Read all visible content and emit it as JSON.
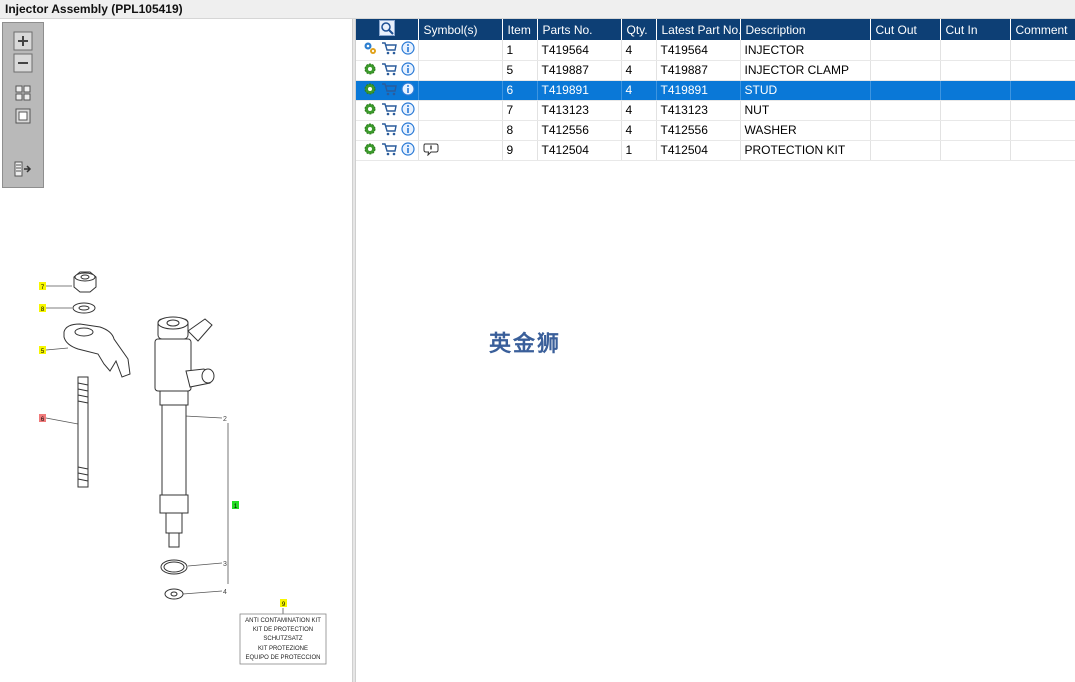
{
  "window": {
    "title": "Injector Assembly (PPL105419)"
  },
  "toolbar": {
    "buttons": [
      "zoom-in",
      "zoom-out",
      "fit-all",
      "fit-window",
      "export"
    ]
  },
  "table": {
    "columns": [
      "",
      "Symbol(s)",
      "Item",
      "Parts No.",
      "Qty.",
      "Latest Part No.",
      "Description",
      "Cut Out",
      "Cut In",
      "Comment"
    ],
    "rows": [
      {
        "item": "1",
        "part_no": "T419564",
        "qty": "4",
        "latest": "T419564",
        "description": "INJECTOR",
        "cut_out": "",
        "cut_in": "",
        "comment": "",
        "symbol": "",
        "selected": false
      },
      {
        "item": "5",
        "part_no": "T419887",
        "qty": "4",
        "latest": "T419887",
        "description": "INJECTOR CLAMP",
        "cut_out": "",
        "cut_in": "",
        "comment": "",
        "symbol": "",
        "selected": false
      },
      {
        "item": "6",
        "part_no": "T419891",
        "qty": "4",
        "latest": "T419891",
        "description": "STUD",
        "cut_out": "",
        "cut_in": "",
        "comment": "",
        "symbol": "",
        "selected": true
      },
      {
        "item": "7",
        "part_no": "T413123",
        "qty": "4",
        "latest": "T413123",
        "description": "NUT",
        "cut_out": "",
        "cut_in": "",
        "comment": "",
        "symbol": "",
        "selected": false
      },
      {
        "item": "8",
        "part_no": "T412556",
        "qty": "4",
        "latest": "T412556",
        "description": "WASHER",
        "cut_out": "",
        "cut_in": "",
        "comment": "",
        "symbol": "",
        "selected": false
      },
      {
        "item": "9",
        "part_no": "T412504",
        "qty": "1",
        "latest": "T412504",
        "description": "PROTECTION KIT",
        "cut_out": "",
        "cut_in": "",
        "comment": "",
        "symbol": "speech-bubble",
        "selected": false
      }
    ]
  },
  "diagram": {
    "callouts": [
      {
        "label": "7",
        "color": "#f7f700"
      },
      {
        "label": "8",
        "color": "#f7f700"
      },
      {
        "label": "5",
        "color": "#f7f700"
      },
      {
        "label": "6",
        "color": "#f07a7a"
      },
      {
        "label": "2"
      },
      {
        "label": "1",
        "color": "#22dd22"
      },
      {
        "label": "3"
      },
      {
        "label": "4"
      },
      {
        "label": "9",
        "color": "#f7f700"
      }
    ],
    "kit_box_lines": [
      "ANTI CONTAMINATION KIT",
      "KIT DE PROTECTION",
      "SCHUTZSATZ",
      "KIT PROTEZIONE",
      "EQUIPO DE PROTECCION"
    ]
  },
  "watermark": "英金狮",
  "colors": {
    "header": "#0d3f75",
    "selection": "#0a78d7",
    "gear": "#3c9a2c",
    "cart": "#2a5c9c",
    "info": "#2b7bd6"
  }
}
